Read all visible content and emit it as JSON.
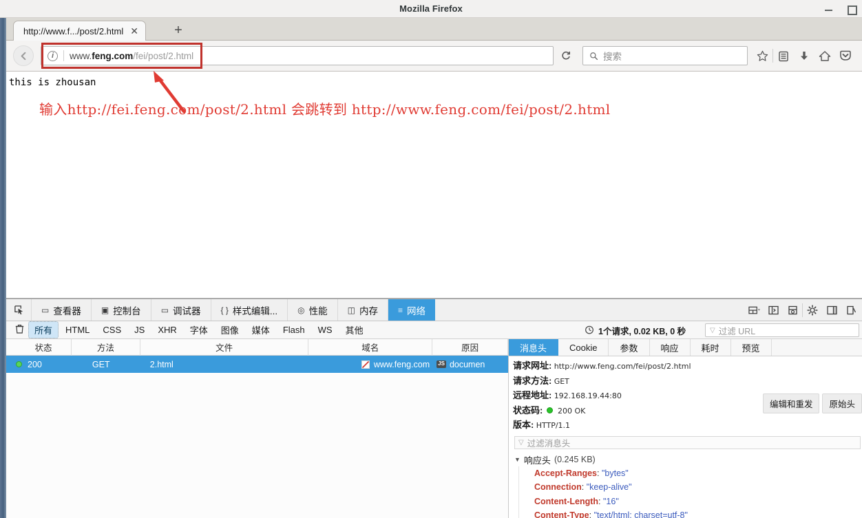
{
  "window": {
    "title": "Mozilla Firefox",
    "controls": {
      "minimize": "–",
      "maximize": "□"
    }
  },
  "tabs": {
    "items": [
      {
        "title": "http://www.f.../post/2.html",
        "close": "✕"
      }
    ],
    "new_tab": "+"
  },
  "navbar": {
    "back_icon": "←",
    "identity_icon": "i",
    "url_scheme_prefix": "www.",
    "url_host": "feng.com",
    "url_path": "/fei/post/2.html",
    "url_full": "www.feng.com/fei/post/2.html",
    "reload_icon": "⟳",
    "search_placeholder": "搜索",
    "search_icon": "⌕",
    "icons": [
      "star-icon",
      "reader-icon",
      "download-icon",
      "home-icon",
      "pocket-icon"
    ]
  },
  "page": {
    "body_text": "this is zhousan",
    "annotation": "输入http://fei.feng.com/post/2.html 会跳转到 http://www.feng.com/fei/post/2.html",
    "annotation_color": "#e03b33",
    "highlight_box_color": "#c0322c"
  },
  "devtools": {
    "tabs": [
      {
        "label": "查看器",
        "glyph": "▭",
        "active": false
      },
      {
        "label": "控制台",
        "glyph": "▣",
        "active": false
      },
      {
        "label": "调试器",
        "glyph": "▭",
        "active": false
      },
      {
        "label": "样式编辑...",
        "glyph": "{ }",
        "active": false
      },
      {
        "label": "性能",
        "glyph": "◎",
        "active": false
      },
      {
        "label": "内存",
        "glyph": "◫",
        "active": false
      },
      {
        "label": "网络",
        "glyph": "≡",
        "active": true
      }
    ],
    "picker_icon": "node-picker-icon",
    "right_icons": [
      "responsive-design-icon",
      "split-console-icon",
      "screenshot-icon",
      "settings-gear-icon",
      "dock-side-icon",
      "close-devtools-icon"
    ],
    "filters": [
      {
        "label": "所有",
        "active": true
      },
      {
        "label": "HTML",
        "active": false
      },
      {
        "label": "CSS",
        "active": false
      },
      {
        "label": "JS",
        "active": false
      },
      {
        "label": "XHR",
        "active": false
      },
      {
        "label": "字体",
        "active": false
      },
      {
        "label": "图像",
        "active": false
      },
      {
        "label": "媒体",
        "active": false
      },
      {
        "label": "Flash",
        "active": false
      },
      {
        "label": "WS",
        "active": false
      },
      {
        "label": "其他",
        "active": false
      }
    ],
    "clear_icon": "trash-icon",
    "summary": "1个请求, 0.02 KB, 0 秒",
    "summary_icon": "stopwatch-icon",
    "url_filter_placeholder": "过滤 URL",
    "accent_color": "#3a9bdc"
  },
  "network_table": {
    "columns": [
      "状态",
      "方法",
      "文件",
      "域名",
      "原因"
    ],
    "rows": [
      {
        "status": "200",
        "method": "GET",
        "file": "2.html",
        "domain": "www.feng.com",
        "cause_badge": "JS",
        "cause": "documen"
      }
    ]
  },
  "details": {
    "tabs": [
      {
        "label": "消息头",
        "active": true
      },
      {
        "label": "Cookie",
        "active": false
      },
      {
        "label": "参数",
        "active": false
      },
      {
        "label": "响应",
        "active": false
      },
      {
        "label": "耗时",
        "active": false
      },
      {
        "label": "预览",
        "active": false
      }
    ],
    "fields": [
      {
        "key": "请求网址:",
        "value": "http://www.feng.com/fei/post/2.html"
      },
      {
        "key": "请求方法:",
        "value": "GET"
      },
      {
        "key": "远程地址:",
        "value": "192.168.19.44:80"
      },
      {
        "key": "状态码:",
        "value": "200 OK",
        "has_dot": true
      },
      {
        "key": "版本:",
        "value": "HTTP/1.1"
      }
    ],
    "actions": [
      "编辑和重发",
      "原始头"
    ],
    "header_filter_placeholder": "过滤消息头",
    "response_group": "响应头",
    "response_group_size": "(0.245 KB)",
    "response_headers": [
      {
        "name": "Accept-Ranges",
        "value": "\"bytes\""
      },
      {
        "name": "Connection",
        "value": "\"keep-alive\""
      },
      {
        "name": "Content-Length",
        "value": "\"16\""
      },
      {
        "name": "Content-Type",
        "value": "\"text/html; charset=utf-8\""
      }
    ]
  }
}
